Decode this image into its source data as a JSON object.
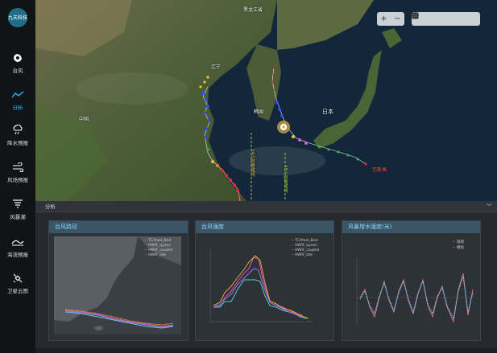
{
  "app": {
    "logo_text": "九天科技"
  },
  "sidebar": {
    "items": [
      {
        "label": "台风",
        "icon": "typhoon-icon",
        "active": false
      },
      {
        "label": "分析",
        "icon": "analysis-icon",
        "active": true
      },
      {
        "label": "降水预报",
        "icon": "rain-icon",
        "active": false
      },
      {
        "label": "风场预报",
        "icon": "wind-icon",
        "active": false
      },
      {
        "label": "风暴潮",
        "icon": "storm-icon",
        "active": false
      },
      {
        "label": "海流预报",
        "icon": "wave-icon",
        "active": false
      },
      {
        "label": "卫星云图",
        "icon": "satellite-icon",
        "active": false
      }
    ]
  },
  "map": {
    "tools": {
      "zoom_in": "+",
      "zoom_out": "−",
      "icons": [
        "locate-icon",
        "layers-icon",
        "fullscreen-icon",
        "print-icon",
        "info-icon"
      ]
    },
    "labels": {
      "north_korea": "黑龙江省",
      "liaoning": "辽宁",
      "korea": "韩国",
      "japan": "日本",
      "china": "中国",
      "typhoon_name": "范斯高",
      "line1": "24小时警戒线",
      "line2": "48小时警戒线"
    }
  },
  "panel": {
    "title": "分析",
    "cards": {
      "path": {
        "title": "台风路径",
        "legend": [
          "TC/Vtask_Best",
          "HWRF_typson",
          "HWRF_coupled",
          "HWRF_tide"
        ]
      },
      "intensity": {
        "title": "台风强度",
        "legend": [
          "TC/Vtask_Best",
          "HWRF_typson",
          "HWRF_coupled",
          "HWRF_tide"
        ]
      },
      "surge": {
        "title": "风暴增水强度(米)",
        "legend": [
          "观测",
          "模拟"
        ]
      }
    }
  },
  "colors": {
    "accent": "#33b6ff",
    "best": "#4fd1c5",
    "typson": "#e05b9e",
    "coupled": "#e8a23a",
    "tide": "#9b6cff",
    "observed": "#e06a6a",
    "simulated": "#63c2ff"
  }
}
